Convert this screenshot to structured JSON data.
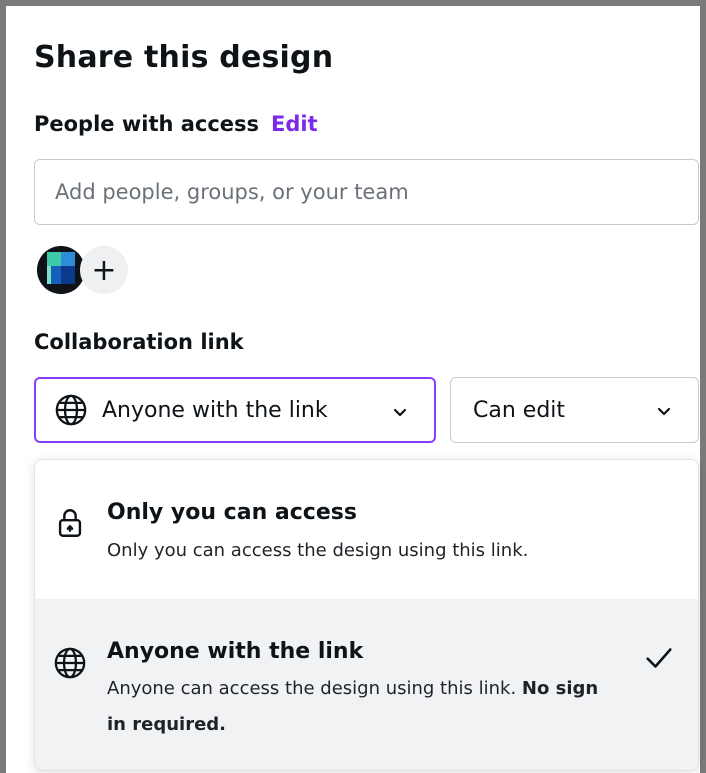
{
  "dialog": {
    "title": "Share this design"
  },
  "people_access": {
    "label": "People with access",
    "edit_label": "Edit",
    "input_placeholder": "Add people, groups, or your team",
    "add_button": "+"
  },
  "collaboration": {
    "label": "Collaboration link",
    "link_select_value": "Anyone with the link",
    "permission_select_value": "Can edit"
  },
  "dropdown": {
    "options": [
      {
        "title": "Only you can access",
        "description": "Only you can access the design using this link.",
        "icon": "lock-icon",
        "selected": false
      },
      {
        "title": "Anyone with the link",
        "description": "Anyone can access the design using this link.",
        "description_bold": "No sign in required.",
        "icon": "globe-icon",
        "selected": true
      }
    ]
  },
  "colors": {
    "accent": "#7d2ae8",
    "focus_border": "#8b3dff",
    "selected_bg": "#f1f2f4",
    "border": "#c7cbd1"
  }
}
